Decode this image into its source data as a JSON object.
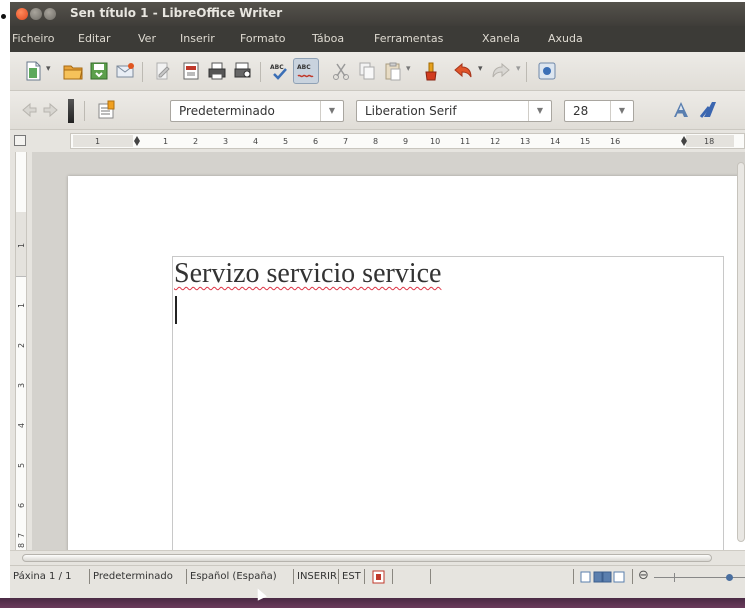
{
  "window": {
    "title": "Sen título 1 - LibreOffice Writer"
  },
  "menu": [
    "Ficheiro",
    "Editar",
    "Ver",
    "Inserir",
    "Formato",
    "Táboa",
    "Ferramentas",
    "Xanela",
    "Axuda"
  ],
  "toolbar": {
    "paragraph_style": "Predeterminado",
    "font_name": "Liberation Serif",
    "font_size": "28"
  },
  "ruler": {
    "horizontal_ticks": [
      "1",
      "1",
      "2",
      "3",
      "4",
      "5",
      "6",
      "7",
      "8",
      "9",
      "10",
      "11",
      "12",
      "13",
      "14",
      "15",
      "16",
      "18"
    ],
    "vertical_ticks": [
      "1",
      "1",
      "2",
      "3",
      "4",
      "5",
      "6",
      "7",
      "8"
    ]
  },
  "document": {
    "text": "Servizo servicio service"
  },
  "status": {
    "page": "Páxina 1 / 1",
    "style": "Predeterminado",
    "language": "Español (España)",
    "insert_mode": "INSERIR",
    "selection_mode": "EST"
  },
  "colors": {
    "menubar": "#3c3b37",
    "titlebar": "#4a4843",
    "close_button": "#e2481f",
    "spell_underline": "#dd3344"
  }
}
